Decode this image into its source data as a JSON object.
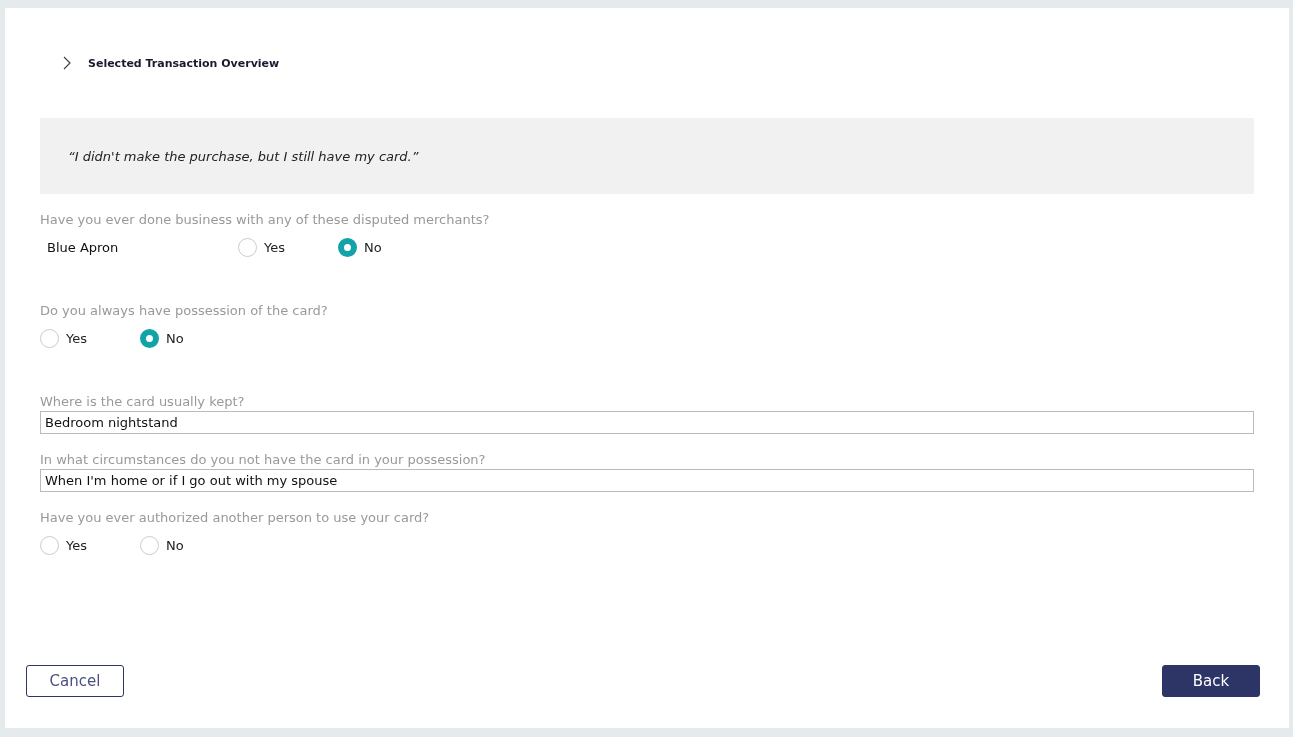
{
  "section": {
    "title": "Selected Transaction Overview",
    "expanded": false
  },
  "quote": "“I didn't make the purchase, but I still have my card.”",
  "questions": [
    {
      "kind": "radio",
      "label": "Have you ever done business with any of these disputed merchants?",
      "subject": "Blue Apron",
      "options": [
        {
          "label": "Yes",
          "selected": false
        },
        {
          "label": "No",
          "selected": true
        }
      ]
    },
    {
      "kind": "radio",
      "label": "Do you always have possession of the card?",
      "options": [
        {
          "label": "Yes",
          "selected": false
        },
        {
          "label": "No",
          "selected": true
        }
      ]
    },
    {
      "kind": "text",
      "label": "Where is the card usually kept?",
      "value": "Bedroom nightstand"
    },
    {
      "kind": "text",
      "label": "In what circumstances do you not have the card in your possession?",
      "value": "When I'm home or if I go out with my spouse"
    },
    {
      "kind": "radio",
      "label": "Have you ever authorized another person to use your card?",
      "options": [
        {
          "label": "Yes",
          "selected": false
        },
        {
          "label": "No",
          "selected": false
        }
      ]
    }
  ],
  "buttons": {
    "cancel": "Cancel",
    "back": "Back"
  }
}
